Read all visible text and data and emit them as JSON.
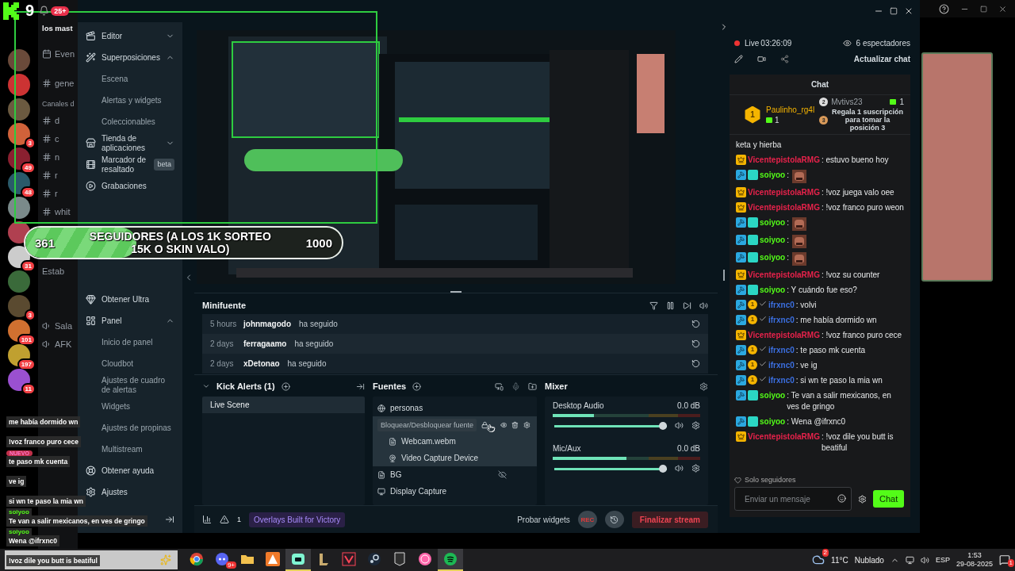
{
  "kick_overlay": {
    "digit": "9",
    "notification_badge": "25+"
  },
  "discord": {
    "servers": [
      {
        "kind": "plain"
      },
      {
        "kind": "plain"
      },
      {
        "kind": "plain"
      },
      {
        "kind": "badged",
        "badge": "3"
      },
      {
        "kind": "badged",
        "badge": "49"
      },
      {
        "kind": "badged",
        "badge": "48"
      },
      {
        "kind": "plain"
      },
      {
        "kind": "plain"
      },
      {
        "kind": "badged",
        "badge": "31"
      },
      {
        "kind": "plain"
      },
      {
        "kind": "badged",
        "badge": "3"
      },
      {
        "kind": "badged",
        "badge": "101"
      },
      {
        "kind": "badged",
        "badge": "197"
      },
      {
        "kind": "badged",
        "badge": "11"
      }
    ],
    "server_title": "los mast",
    "events": "Even",
    "top_channel": "gene",
    "category": "Canales d",
    "channels": [
      "d",
      "c",
      "n",
      "r",
      "r",
      "whit"
    ],
    "status": "Estab",
    "voice_channels": [
      "Sala",
      "AFK"
    ]
  },
  "sidebar": {
    "top": [
      {
        "label": "Editor",
        "kind": "group",
        "expanded": false
      },
      {
        "label": "Superposiciones",
        "kind": "group",
        "expanded": true
      },
      {
        "label": "Escena",
        "kind": "sub"
      },
      {
        "label": "Alertas y widgets",
        "kind": "sub"
      },
      {
        "label": "Coleccionables",
        "kind": "sub"
      },
      {
        "label": "Tienda de aplicaciones",
        "kind": "group",
        "expanded": false
      },
      {
        "label": "Marcador de resaltado",
        "kind": "item",
        "badge": "beta"
      },
      {
        "label": "Grabaciones",
        "kind": "item"
      }
    ],
    "bottom": [
      {
        "label": "Obtener Ultra",
        "kind": "item"
      },
      {
        "label": "Panel",
        "kind": "group",
        "expanded": true
      },
      {
        "label": "Inicio de panel",
        "kind": "sub"
      },
      {
        "label": "Cloudbot",
        "kind": "sub"
      },
      {
        "label": "Ajustes de cuadro de alertas",
        "kind": "sub"
      },
      {
        "label": "Widgets",
        "kind": "sub"
      },
      {
        "label": "Ajustes de propinas",
        "kind": "sub"
      },
      {
        "label": "Multistream",
        "kind": "sub"
      },
      {
        "label": "Obtener ayuda",
        "kind": "item"
      },
      {
        "label": "Ajustes",
        "kind": "item"
      }
    ]
  },
  "minifuente": {
    "title": "Minifuente",
    "rows": [
      {
        "time": "5 hours",
        "user": "johnmagodo",
        "action": "ha seguido"
      },
      {
        "time": "2 days",
        "user": "ferragaamo",
        "action": "ha seguido"
      },
      {
        "time": "2 days",
        "user": "xDetonao",
        "action": "ha seguido"
      }
    ]
  },
  "scenes": {
    "title": "Kick Alerts (1)",
    "items": [
      {
        "label": "Live Scene",
        "selected": true
      }
    ]
  },
  "sources": {
    "title": "Fuentes",
    "items": [
      {
        "kind": "scene",
        "label": "personas",
        "visible": true
      },
      {
        "kind": "folder",
        "tooltip": "Bloquear/Desbloquear fuente",
        "visible": true,
        "children": [
          {
            "kind": "file",
            "label": "Webcam.webm"
          },
          {
            "kind": "camera",
            "label": "Video Capture Device"
          }
        ]
      },
      {
        "kind": "file",
        "label": "BG",
        "visible": false
      },
      {
        "kind": "display",
        "label": "Display Capture",
        "visible": true
      }
    ]
  },
  "mixer": {
    "title": "Mixer",
    "channels": [
      {
        "name": "Desktop Audio",
        "reading": "0.0 dB",
        "level": 1,
        "meter": {
          "level": 0.28
        }
      },
      {
        "name": "Mic/Aux",
        "reading": "0.0 dB",
        "level": 1,
        "meter": {
          "level": 0.5
        }
      }
    ]
  },
  "bottom_bar": {
    "alerts": "1",
    "promo": "Overlays Built for Victory",
    "test": "Probar widgets",
    "rec": "REC",
    "end": "Finalizar stream"
  },
  "chat_panel": {
    "live": "Live",
    "time": "03:26:09",
    "viewers": "6 espectadores",
    "refresh": "Actualizar chat",
    "title": "Chat",
    "leaders": [
      {
        "rank": "1",
        "name": "Paulinho_rg4l",
        "count": "1"
      },
      {
        "rank": "2",
        "name": "Mvtivs23",
        "count": "1"
      },
      {
        "rank": "3",
        "text": "Regala 1 suscripción para tomar la posición 3"
      }
    ],
    "messages": [
      {
        "kind": "continuation",
        "text": "keta y hierba"
      },
      {
        "kind": "vip",
        "user": "VicentepistolaRMG",
        "color": "#e8224b",
        "text": ": estuvo bueno hoy"
      },
      {
        "kind": "mod_sub",
        "user": "soiyoo",
        "color": "#53fc18",
        "text": ":",
        "emote": true
      },
      {
        "kind": "vip",
        "user": "VicentepistolaRMG",
        "color": "#e8224b",
        "text": ": !voz juega valo oee"
      },
      {
        "kind": "vip",
        "user": "VicentepistolaRMG",
        "color": "#e8224b",
        "text": ": !voz franco puro weon"
      },
      {
        "kind": "mod_sub",
        "user": "soiyoo",
        "color": "#53fc18",
        "text": ":",
        "emote": true
      },
      {
        "kind": "mod_sub",
        "user": "soiyoo",
        "color": "#53fc18",
        "text": ":",
        "emote": true
      },
      {
        "kind": "mod_sub",
        "user": "soiyoo",
        "color": "#53fc18",
        "text": ":",
        "emote": true
      },
      {
        "kind": "vip",
        "user": "VicentepistolaRMG",
        "color": "#e8224b",
        "text": ": !voz su counter"
      },
      {
        "kind": "mod_sub",
        "user": "soiyoo",
        "color": "#53fc18",
        "text": ": Y cuándo fue eso?"
      },
      {
        "kind": "mod_gift",
        "gift": "1",
        "user": "ifrxnc0",
        "color": "#3b6fe0",
        "text": ": volvi"
      },
      {
        "kind": "mod_gift",
        "gift": "1",
        "user": "ifrxnc0",
        "color": "#3b6fe0",
        "text": ": me había dormido wn"
      },
      {
        "kind": "vip",
        "user": "VicentepistolaRMG",
        "color": "#e8224b",
        "text": ": !voz franco puro cece"
      },
      {
        "kind": "mod_gift",
        "gift": "1",
        "user": "ifrxnc0",
        "color": "#3b6fe0",
        "text": ": te paso mk cuenta"
      },
      {
        "kind": "mod_gift",
        "gift": "1",
        "user": "ifrxnc0",
        "color": "#3b6fe0",
        "text": ": ve ig"
      },
      {
        "kind": "mod_gift",
        "gift": "1",
        "user": "ifrxnc0",
        "color": "#3b6fe0",
        "text": ": si wn te paso la mia wn"
      },
      {
        "kind": "mod_sub",
        "user": "soiyoo",
        "color": "#53fc18",
        "text": ": Te van a salir mexicanos, en ves de gringo"
      },
      {
        "kind": "mod_sub",
        "user": "soiyoo",
        "color": "#53fc18",
        "text": ": Wena @ifrxnc0"
      },
      {
        "kind": "vip",
        "user": "VicentepistolaRMG",
        "color": "#e8224b",
        "text": ": !voz dile you butt is beatiful"
      }
    ],
    "mode": "Solo seguidores",
    "input": {
      "placeholder": "Enviar un mensaje"
    },
    "send": "Chat"
  },
  "followers_goal": {
    "current": "361",
    "title_lines": [
      "SEGUIDORES (A LOS 1K SORTEO",
      "15K O SKIN VALO)"
    ],
    "goal": "1000",
    "level": 0.35
  },
  "overlay_chat": [
    {
      "kind": "plain",
      "text": "me había dormido wn"
    },
    {
      "kind": "plain",
      "text": "!voz franco puro cece"
    },
    {
      "kind": "new",
      "badge": "NUEVO",
      "text": "te paso mk cuenta"
    },
    {
      "kind": "plain",
      "text": "ve ig"
    },
    {
      "kind": "plain",
      "text": "si wn te paso la mia wn"
    },
    {
      "kind": "named",
      "user": "soiyoo",
      "text": "Te van a salir mexicanos, en ves de gringo"
    },
    {
      "kind": "named",
      "user": "soiyoo",
      "text": "Wena @ifrxnc0"
    },
    {
      "kind": "plain",
      "text": "!voz dile you butt is beatiful"
    }
  ],
  "taskbar": {
    "apps": [
      {
        "kind": "chrome",
        "selected": false
      },
      {
        "kind": "discord",
        "badge": "9+",
        "selected": false
      },
      {
        "kind": "folder",
        "selected": false
      },
      {
        "kind": "orange",
        "selected": false
      },
      {
        "kind": "streamlabs",
        "selected": true
      },
      {
        "kind": "league",
        "selected": false
      },
      {
        "kind": "valorant",
        "selected": false
      },
      {
        "kind": "steam",
        "selected": false
      },
      {
        "kind": "epic",
        "selected": false
      },
      {
        "kind": "osu",
        "selected": false
      },
      {
        "kind": "spotify",
        "selected": true
      }
    ],
    "weather": {
      "badge": "2",
      "temp": "11°C",
      "condition": "Nublado"
    },
    "language": "ESP",
    "time": "1:53",
    "date": "29-08-2025",
    "notifications": "1"
  }
}
